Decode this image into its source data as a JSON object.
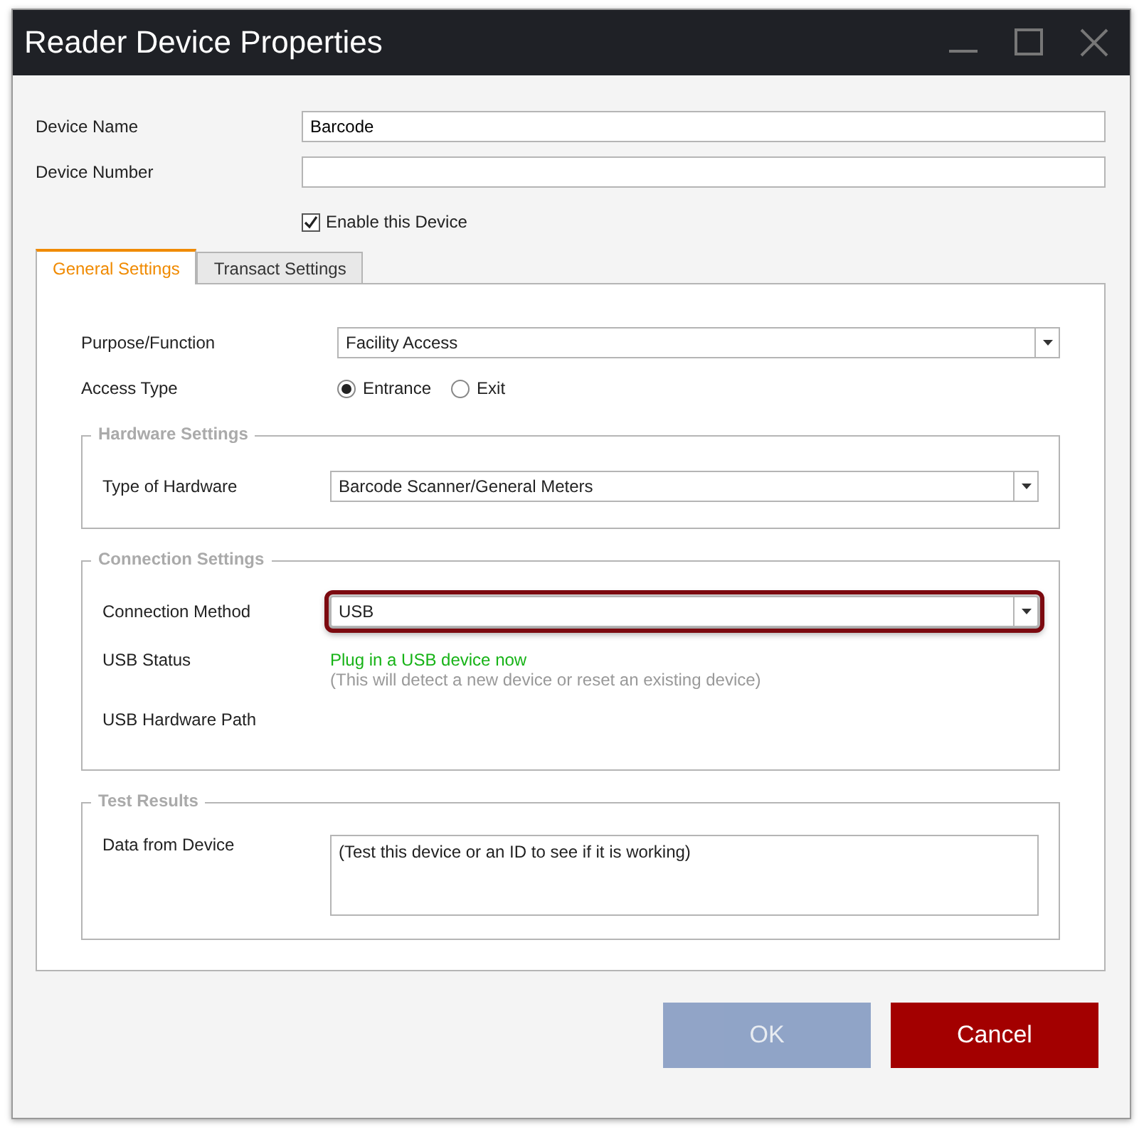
{
  "window": {
    "title": "Reader Device Properties"
  },
  "fields": [
    {
      "label": "Device Name",
      "value": "Barcode"
    },
    {
      "label": "Device Number"
    }
  ],
  "enable_checkbox": {
    "label": "Enable this Device",
    "checked": true
  },
  "tabs": [
    {
      "label": "General Settings",
      "selected": true
    },
    {
      "label": "Transact Settings",
      "selected": false
    }
  ],
  "general": {
    "purpose": {
      "label": "Purpose/Function",
      "value": "Facility Access"
    },
    "access_type": {
      "label": "Access Type",
      "options": [
        {
          "label": "Entrance",
          "selected": true
        },
        {
          "label": "Exit",
          "selected": false
        }
      ]
    },
    "groups": [
      {
        "title": "Hardware Settings",
        "rows": [
          {
            "kind": "dropdown",
            "label": "Type of Hardware",
            "value": "Barcode Scanner/General Meters",
            "highlighted": false
          }
        ]
      },
      {
        "title": "Connection Settings",
        "rows": [
          {
            "kind": "dropdown",
            "label": "Connection Method",
            "value": "USB",
            "highlighted": true
          },
          {
            "kind": "status",
            "label": "USB Status",
            "status": "Plug in a USB device now",
            "note": "(This will detect a new device or reset an existing device)"
          },
          {
            "kind": "empty",
            "label": "USB Hardware Path"
          }
        ]
      },
      {
        "title": "Test Results",
        "rows": [
          {
            "kind": "textarea",
            "label": "Data from Device",
            "value": "(Test this device or an ID to see if it is working)"
          }
        ]
      }
    ]
  },
  "buttons": [
    {
      "kind": "ok",
      "label": "OK",
      "disabled": true
    },
    {
      "kind": "cancel",
      "label": "Cancel",
      "disabled": false
    }
  ]
}
